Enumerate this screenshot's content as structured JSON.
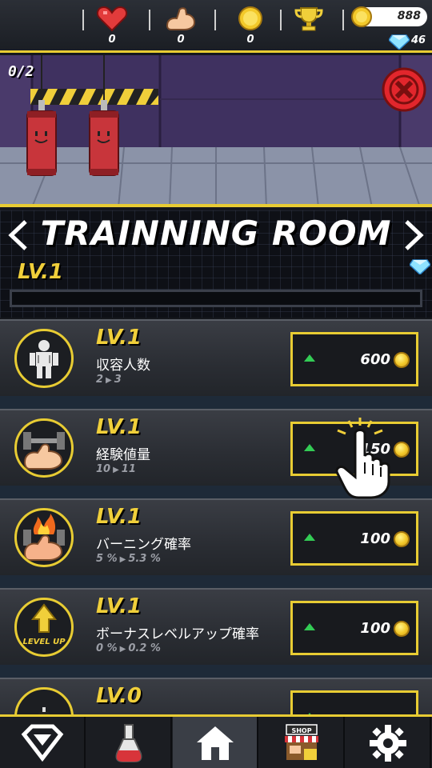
{
  "stats": {
    "hearts": "0",
    "strength": "0",
    "coins_collected": "0",
    "trophy": "",
    "coin_balance": "888",
    "gems": "46"
  },
  "room": {
    "capacity_label": "0/2",
    "title": "TRAINNING ROOM",
    "level": "LV.1",
    "xp_progress": 0
  },
  "upgrades": [
    {
      "level": "LV.1",
      "name": "収容人数",
      "from": "2",
      "to": "3",
      "price": "600",
      "icon": "trainee-icon"
    },
    {
      "level": "LV.1",
      "name": "経験値量",
      "from": "10",
      "to": "11",
      "price": "150",
      "icon": "dumbbell-arm-icon"
    },
    {
      "level": "LV.1",
      "name": "バーニング確率",
      "from": "5 %",
      "to": "5.3 %",
      "price": "100",
      "icon": "burning-arm-icon"
    },
    {
      "level": "LV.1",
      "name": "ボーナスレベルアップ確率",
      "from": "0 %",
      "to": "0.2 %",
      "price": "100",
      "icon": "level-up-icon"
    },
    {
      "level": "LV.0",
      "name": "",
      "from": "",
      "to": "",
      "price": "",
      "icon": "locked-item-icon"
    }
  ],
  "badge_text": {
    "level_up": "LEVEL UP"
  },
  "nav": {
    "items": [
      "hero-icon",
      "potion-icon",
      "home-icon",
      "shop-icon",
      "settings-icon"
    ],
    "shop_label": "SHOP",
    "active": "home-icon"
  },
  "colors": {
    "accent": "#e8cc33",
    "up_arrow": "#33cc55",
    "gem": "#8fe3ff"
  }
}
